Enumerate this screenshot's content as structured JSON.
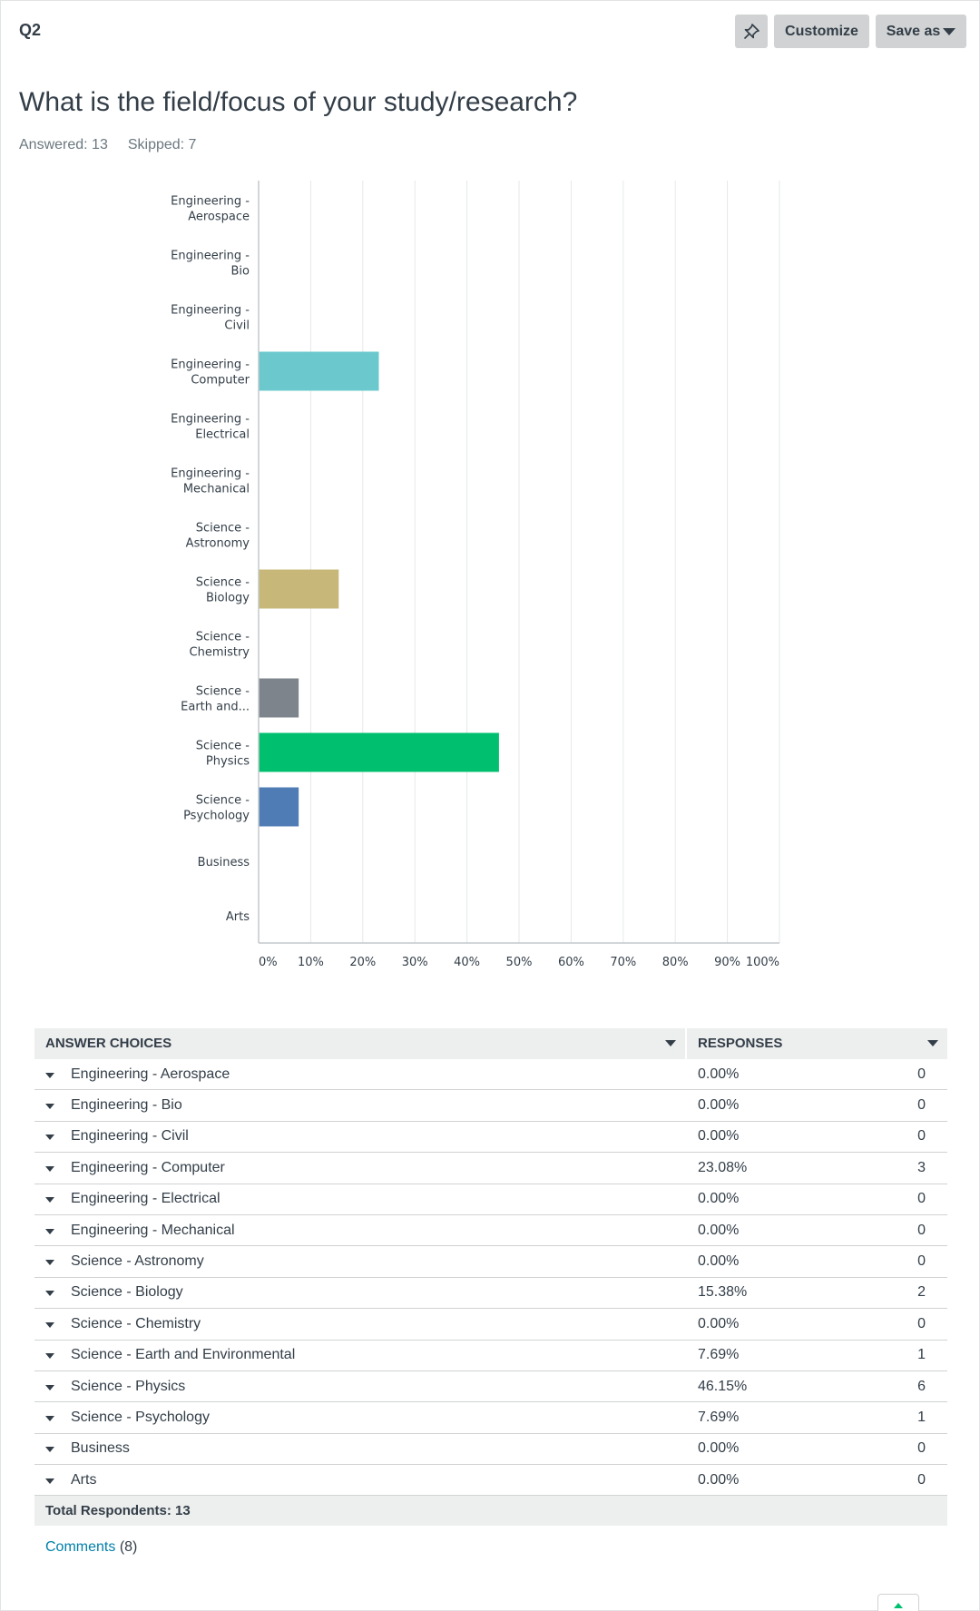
{
  "question": {
    "number": "Q2",
    "title": "What is the field/focus of your study/research?",
    "answered_label": "Answered: 13",
    "skipped_label": "Skipped: 7"
  },
  "toolbar": {
    "pin_icon": "pin-icon",
    "customize_label": "Customize",
    "save_as_label": "Save as"
  },
  "chart_data": {
    "type": "bar",
    "orientation": "horizontal",
    "categories": [
      [
        "Engineering -",
        "Aerospace"
      ],
      [
        "Engineering -",
        "Bio"
      ],
      [
        "Engineering -",
        "Civil"
      ],
      [
        "Engineering -",
        "Computer"
      ],
      [
        "Engineering -",
        "Electrical"
      ],
      [
        "Engineering -",
        "Mechanical"
      ],
      [
        "Science -",
        "Astronomy"
      ],
      [
        "Science -",
        "Biology"
      ],
      [
        "Science -",
        "Chemistry"
      ],
      [
        "Science -",
        "Earth and..."
      ],
      [
        "Science -",
        "Physics"
      ],
      [
        "Science -",
        "Psychology"
      ],
      [
        "Business"
      ],
      [
        "Arts"
      ]
    ],
    "values": [
      0,
      0,
      0,
      23.08,
      0,
      0,
      0,
      15.38,
      0,
      7.69,
      46.15,
      7.69,
      0,
      0
    ],
    "colors": [
      "#6bc8cd",
      "#6bc8cd",
      "#6bc8cd",
      "#6bc8cd",
      "#6bc8cd",
      "#6bc8cd",
      "#6bc8cd",
      "#c7b879",
      "#c7b879",
      "#7d848b",
      "#00bf6f",
      "#507cb6",
      "#507cb6",
      "#507cb6"
    ],
    "x_ticks": [
      "0%",
      "10%",
      "20%",
      "30%",
      "40%",
      "50%",
      "60%",
      "70%",
      "80%",
      "90%",
      "100%"
    ],
    "xlim": [
      0,
      100
    ],
    "grid": true
  },
  "table": {
    "header_choice": "ANSWER CHOICES",
    "header_responses": "RESPONSES",
    "rows": [
      {
        "choice": "Engineering - Aerospace",
        "pct": "0.00%",
        "count": "0"
      },
      {
        "choice": "Engineering - Bio",
        "pct": "0.00%",
        "count": "0"
      },
      {
        "choice": "Engineering - Civil",
        "pct": "0.00%",
        "count": "0"
      },
      {
        "choice": "Engineering - Computer",
        "pct": "23.08%",
        "count": "3"
      },
      {
        "choice": "Engineering - Electrical",
        "pct": "0.00%",
        "count": "0"
      },
      {
        "choice": "Engineering - Mechanical",
        "pct": "0.00%",
        "count": "0"
      },
      {
        "choice": "Science - Astronomy",
        "pct": "0.00%",
        "count": "0"
      },
      {
        "choice": "Science - Biology",
        "pct": "15.38%",
        "count": "2"
      },
      {
        "choice": "Science - Chemistry",
        "pct": "0.00%",
        "count": "0"
      },
      {
        "choice": "Science - Earth and Environmental",
        "pct": "7.69%",
        "count": "1"
      },
      {
        "choice": "Science - Physics",
        "pct": "46.15%",
        "count": "6"
      },
      {
        "choice": "Science - Psychology",
        "pct": "7.69%",
        "count": "1"
      },
      {
        "choice": "Business",
        "pct": "0.00%",
        "count": "0"
      },
      {
        "choice": "Arts",
        "pct": "0.00%",
        "count": "0"
      }
    ],
    "total_label": "Total Respondents: 13"
  },
  "comments": {
    "link_label": "Comments",
    "count_label": "(8)"
  }
}
